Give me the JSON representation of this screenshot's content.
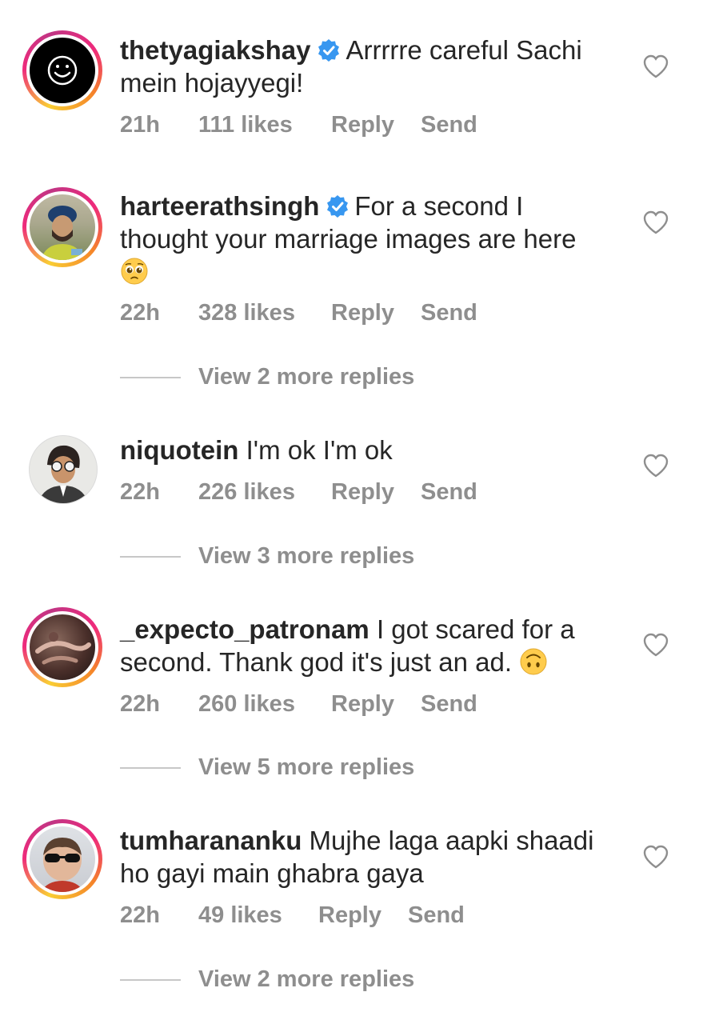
{
  "comments": [
    {
      "username": "thetyagiakshay",
      "verified": true,
      "text": "Arrrrre careful Sachi mein hojayyegi!",
      "line1": "Arrrrre careful Sachi",
      "line2": "mein hojayyegi!",
      "time": "21h",
      "likes": "111 likes",
      "reply": "Reply",
      "send": "Send"
    },
    {
      "username": "harteerathsingh",
      "verified": true,
      "line1": "For a second I",
      "line2": "thought your marriage images are here",
      "emoji": "pleading-face-emoji",
      "time": "22h",
      "likes": "328 likes",
      "reply": "Reply",
      "send": "Send",
      "view_replies": "View 2 more replies"
    },
    {
      "username": "niquotein",
      "verified": false,
      "line1": "I'm ok I'm ok",
      "time": "22h",
      "likes": "226 likes",
      "reply": "Reply",
      "send": "Send",
      "view_replies": "View 3 more replies"
    },
    {
      "username": "_expecto_patronam",
      "verified": false,
      "line1": "I got scared for a",
      "line2": "second. Thank god it's just an ad.",
      "emoji": "upside-down-face-emoji",
      "time": "22h",
      "likes": "260 likes",
      "reply": "Reply",
      "send": "Send",
      "view_replies": "View 5 more replies"
    },
    {
      "username": "tumharananku",
      "verified": false,
      "line1": "Mujhe laga aapki shaadi",
      "line2": "ho gayi main ghabra gaya",
      "time": "22h",
      "likes": "49 likes",
      "reply": "Reply",
      "send": "Send",
      "view_replies": "View 2 more replies"
    }
  ],
  "colors": {
    "verified": "#3897f0",
    "meta_text": "#8e8e8e",
    "main_text": "#262626"
  },
  "icons": {
    "like": "heart-outline-icon",
    "verified": "verified-badge-icon"
  }
}
